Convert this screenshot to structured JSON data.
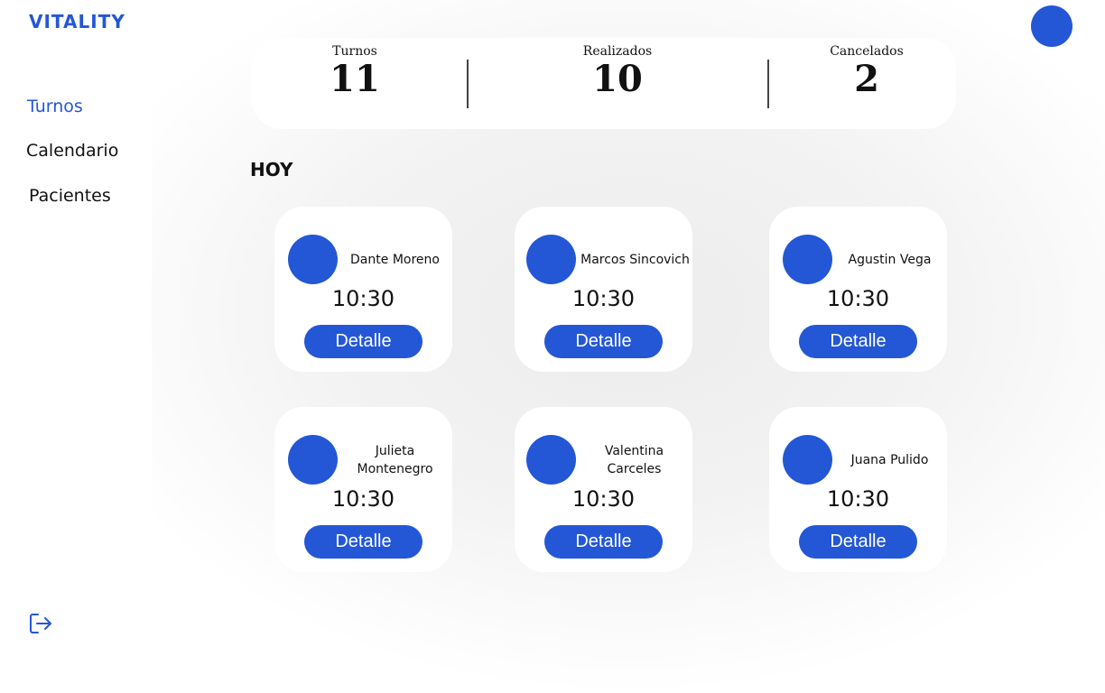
{
  "app": {
    "logo": "VITALITY"
  },
  "sidebar": {
    "items": [
      {
        "label": "Turnos",
        "active": true
      },
      {
        "label": "Calendario",
        "active": false
      },
      {
        "label": "Pacientes",
        "active": false
      }
    ],
    "logout_icon": "logout-icon"
  },
  "stats": [
    {
      "label": "Turnos",
      "value": "11"
    },
    {
      "label": "Realizados",
      "value": "10"
    },
    {
      "label": "Cancelados",
      "value": "2"
    }
  ],
  "section": {
    "title": "HOY"
  },
  "appointments": [
    {
      "name": "Dante Moreno",
      "time": "10:30",
      "button": "Detalle"
    },
    {
      "name": "Marcos Sincovich",
      "time": "10:30",
      "button": "Detalle"
    },
    {
      "name": "Agustin Vega",
      "time": "10:30",
      "button": "Detalle"
    },
    {
      "name": "Julieta Montenegro",
      "time": "10:30",
      "button": "Detalle"
    },
    {
      "name": "Valentina Carceles",
      "time": "10:30",
      "button": "Detalle"
    },
    {
      "name": "Juana Pulido",
      "time": "10:30",
      "button": "Detalle"
    }
  ],
  "colors": {
    "accent": "#2457d6",
    "background": "#f3f3f3",
    "card": "#ffffff"
  }
}
